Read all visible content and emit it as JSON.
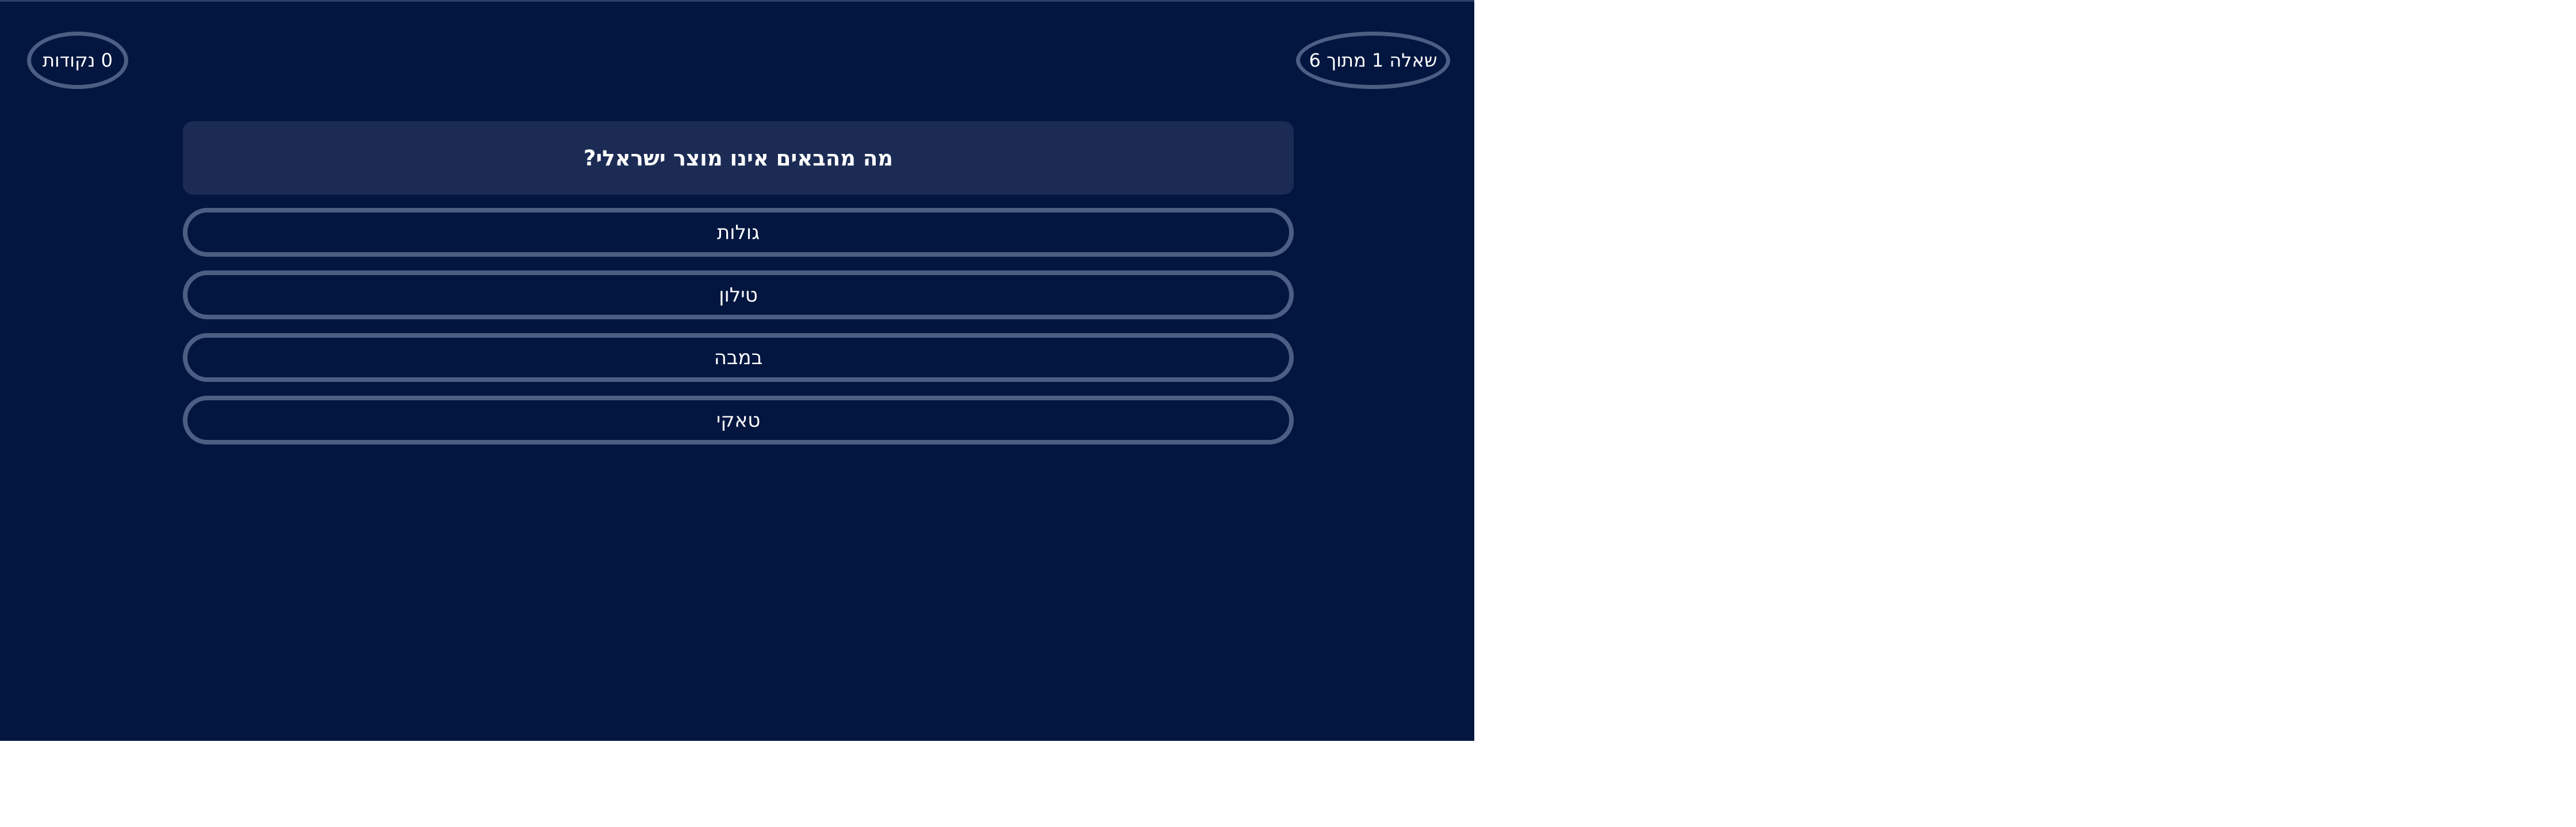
{
  "colors": {
    "background": "#031640",
    "card": "#1b2b54",
    "border": "#4c5e83",
    "text": "#ffffff"
  },
  "header": {
    "progress": "שאלה 1 מתוך 6",
    "score": "0 נקודות"
  },
  "question": {
    "text": "מה מהבאים אינו מוצר ישראלי?"
  },
  "answers": [
    {
      "label": "גולות"
    },
    {
      "label": "טילון"
    },
    {
      "label": "במבה"
    },
    {
      "label": "טאקי"
    }
  ]
}
